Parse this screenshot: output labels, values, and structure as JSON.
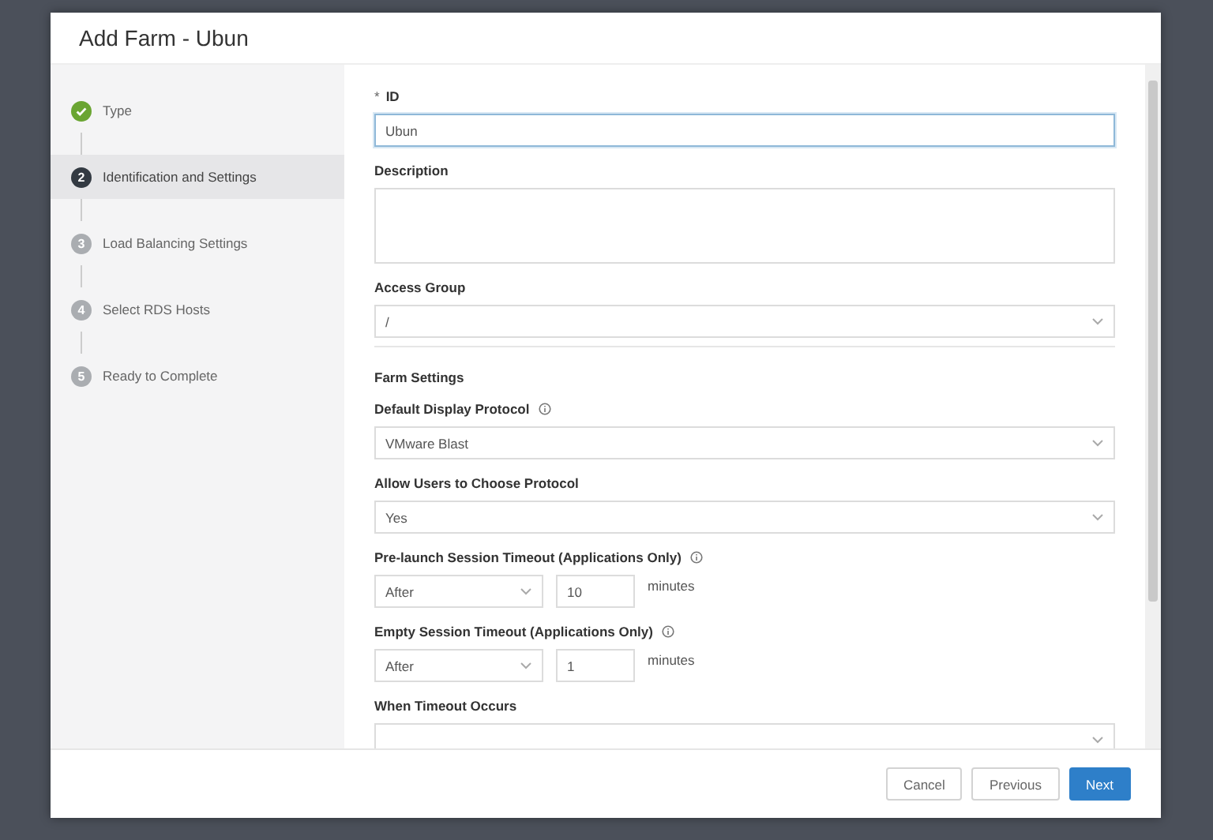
{
  "dialog": {
    "title": "Add Farm - Ubun"
  },
  "steps": [
    {
      "label": "Type",
      "completed": true,
      "selected": false
    },
    {
      "number": "2",
      "label": "Identification and Settings",
      "completed": false,
      "selected": true
    },
    {
      "number": "3",
      "label": "Load Balancing Settings",
      "completed": false,
      "selected": false
    },
    {
      "number": "4",
      "label": "Select RDS Hosts",
      "completed": false,
      "selected": false
    },
    {
      "number": "5",
      "label": "Ready to Complete",
      "completed": false,
      "selected": false
    }
  ],
  "fields": [
    {
      "kind": "text",
      "label": "ID",
      "required_mark": "*",
      "value": "Ubun",
      "focused": true
    },
    {
      "kind": "textarea",
      "label": "Description",
      "focused": false
    },
    {
      "kind": "select",
      "label": "Access Group",
      "value": "/",
      "focused": false
    },
    {
      "kind": "divider"
    },
    {
      "kind": "heading",
      "label": "Farm Settings"
    },
    {
      "kind": "select",
      "label": "Default Display Protocol",
      "info": true,
      "value": "VMware Blast",
      "focused": false
    },
    {
      "kind": "select",
      "label": "Allow Users to Choose Protocol",
      "value": "Yes",
      "focused": false
    },
    {
      "kind": "timeout",
      "label": "Pre-launch Session Timeout (Applications Only)",
      "info": true,
      "mode": "After",
      "amount": "10",
      "unit": "minutes"
    },
    {
      "kind": "timeout",
      "label": "Empty Session Timeout (Applications Only)",
      "info": true,
      "mode": "After",
      "amount": "1",
      "unit": "minutes"
    },
    {
      "kind": "select",
      "label": "When Timeout Occurs",
      "focused": false
    }
  ],
  "buttons": [
    {
      "label": "Cancel",
      "primary": false
    },
    {
      "label": "Previous",
      "primary": false
    },
    {
      "label": "Next",
      "primary": true
    }
  ]
}
